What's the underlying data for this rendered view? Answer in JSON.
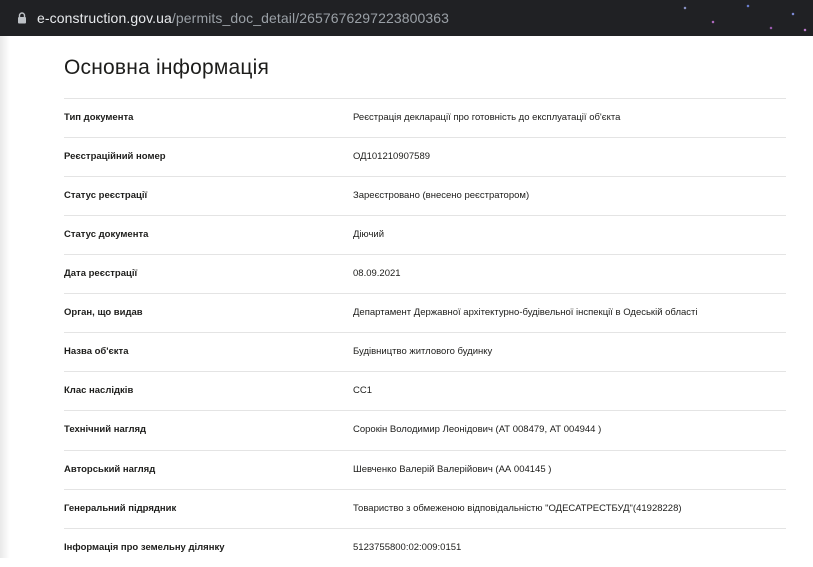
{
  "browser": {
    "url_host": "e-construction.gov.ua",
    "url_path": "/permits_doc_detail/2657676297223800363"
  },
  "page": {
    "title": "Основна інформація",
    "rows": [
      {
        "label": "Тип документа",
        "value": "Реєстрація декларації про готовність до експлуатації об'єкта"
      },
      {
        "label": "Реєстраційний номер",
        "value": "ОД101210907589"
      },
      {
        "label": "Статус реєстрації",
        "value": "Зареєстровано (внесено реєстратором)"
      },
      {
        "label": "Статус документа",
        "value": "Діючий"
      },
      {
        "label": "Дата реєстрації",
        "value": "08.09.2021"
      },
      {
        "label": "Орган, що видав",
        "value": "Департамент Державної архітектурно-будівельної інспекції в Одеській області"
      },
      {
        "label": "Назва об'єкта",
        "value": "Будівництво житлового будинку"
      },
      {
        "label": "Клас наслідків",
        "value": "СС1"
      },
      {
        "label": "Технічний нагляд",
        "value": "Сорокін Володимир Леонідович (АТ 008479, АТ 004944 )"
      },
      {
        "label": "Авторський нагляд",
        "value": "Шевченко Валерій Валерійович (АА 004145 )"
      },
      {
        "label": "Генеральний підрядник",
        "value": "Товариство з обмеженою відповідальністю \"ОДЕСАТРЕСТБУД\"(41928228)"
      },
      {
        "label": "Інформація про земельну ділянку",
        "value": "5123755800:02:009:0151"
      }
    ]
  }
}
